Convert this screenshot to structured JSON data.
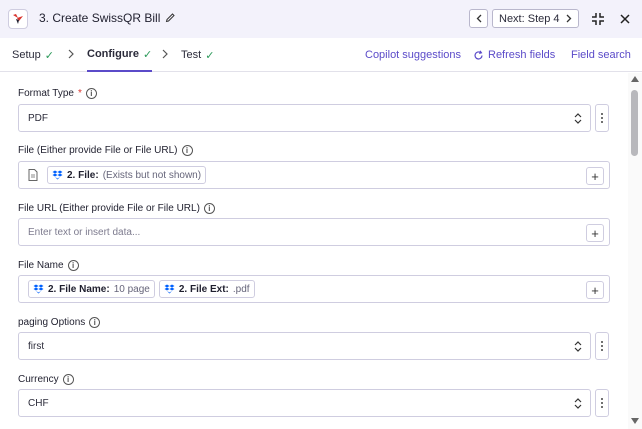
{
  "header": {
    "step_title": "3. Create SwissQR Bill",
    "next_label": "Next: Step 4"
  },
  "tabs": [
    {
      "label": "Setup"
    },
    {
      "label": "Configure"
    },
    {
      "label": "Test"
    }
  ],
  "links": {
    "copilot": "Copilot suggestions",
    "refresh": "Refresh fields",
    "field_search": "Field search"
  },
  "fields": {
    "format_type": {
      "label": "Format Type",
      "required_mark": "*",
      "value": "PDF"
    },
    "file": {
      "label": "File (Either provide File or File URL)",
      "pill_name": "2. File:",
      "pill_value": "(Exists but not shown)"
    },
    "file_url": {
      "label": "File URL (Either provide File or File URL)",
      "placeholder": "Enter text or insert data..."
    },
    "file_name": {
      "label": "File Name",
      "pill1_name": "2. File Name:",
      "pill1_value": "10 page",
      "pill2_name": "2. File Ext:",
      "pill2_value": ".pdf"
    },
    "paging_options": {
      "label": "paging Options",
      "value": "first"
    },
    "currency": {
      "label": "Currency",
      "value": "CHF"
    }
  },
  "colors": {
    "accent": "#5b4bc9",
    "success": "#2c9a5a",
    "required": "#d9322b",
    "header_bg": "#f3f2fb",
    "dropbox_blue": "#0061fe"
  }
}
